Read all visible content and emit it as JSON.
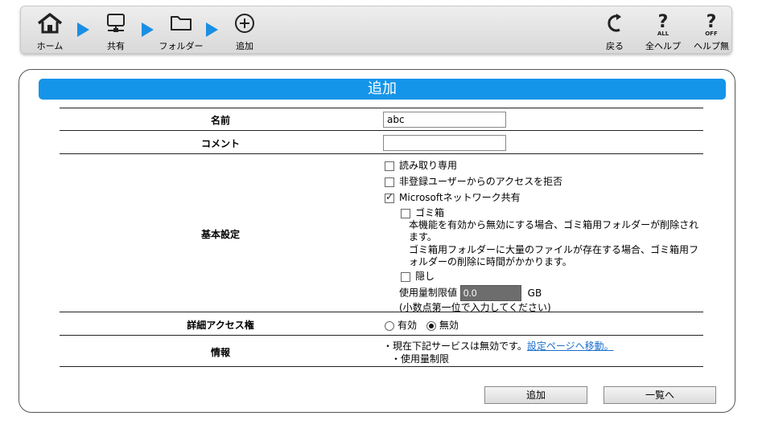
{
  "toolbar": {
    "breadcrumb": [
      {
        "label": "ホーム",
        "icon": "home-icon"
      },
      {
        "label": "共有",
        "icon": "network-share-icon"
      },
      {
        "label": "フォルダー",
        "icon": "folder-icon"
      },
      {
        "label": "追加",
        "icon": "add-circle-icon"
      }
    ],
    "back_label": "戻る",
    "all_help_label": "全ヘルプ",
    "all_help_badge": "ALL",
    "help_off_label": "ヘルプ無",
    "help_off_badge": "OFF",
    "accent_color": "#1a8fe3"
  },
  "panel": {
    "title": "追加",
    "title_color": "#1595e9"
  },
  "form": {
    "name": {
      "label": "名前",
      "value": "abc"
    },
    "comment": {
      "label": "コメント",
      "value": ""
    },
    "basic": {
      "label": "基本設定",
      "readonly": {
        "label": "読み取り専用",
        "checked": false
      },
      "deny_guest": {
        "label": "非登録ユーザーからのアクセスを拒否",
        "checked": false
      },
      "ms_share": {
        "label": "Microsoftネットワーク共有",
        "checked": true
      },
      "trash": {
        "label": "ゴミ箱",
        "checked": false
      },
      "trash_note1": "本機能を有効から無効にする場合、ゴミ箱用フォルダーが削除されます。",
      "trash_note2": "ゴミ箱用フォルダーに大量のファイルが存在する場合、ゴミ箱用フォルダーの削除に時間がかかります。",
      "hidden": {
        "label": "隠し",
        "checked": false
      },
      "quota_label": "使用量制限値",
      "quota_value": "0.0",
      "quota_unit": "GB",
      "quota_hint": "(小数点第一位で入力してください)"
    },
    "acl": {
      "label": "詳細アクセス権",
      "enabled_label": "有効",
      "disabled_label": "無効",
      "selected": "無効"
    },
    "info": {
      "label": "情報",
      "line1": "現在下記サービスは無効です。",
      "link": "設定ページへ移動。",
      "line2": "使用量制限"
    }
  },
  "buttons": {
    "add": "追加",
    "list": "一覧へ"
  }
}
